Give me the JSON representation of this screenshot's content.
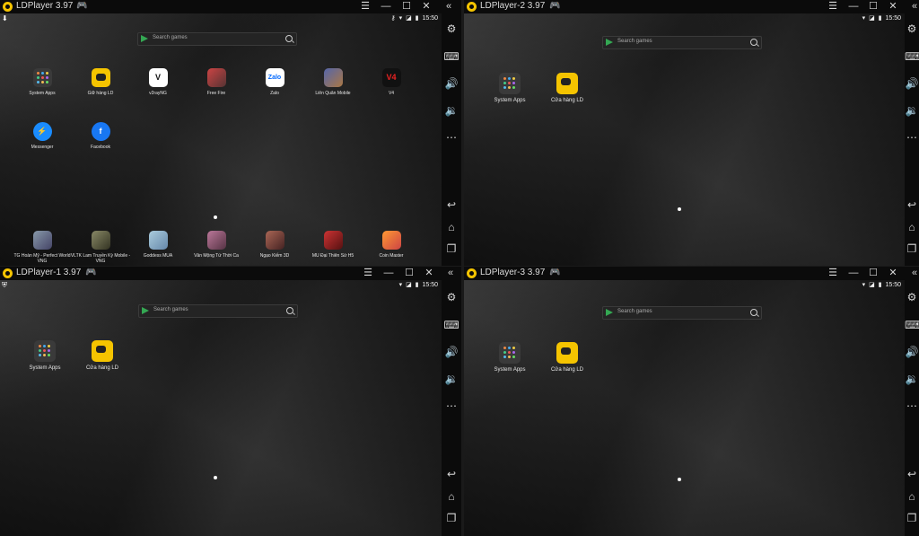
{
  "windows": {
    "w0": {
      "title": "LDPlayer 3.97",
      "time": "15:50",
      "search_placeholder": "Search games",
      "apps_top": [
        "System Apps",
        "Giữ hàng LD",
        "v2rayNG",
        "Free Fire",
        "Zalo",
        "Liên Quân Mobile",
        "V4"
      ],
      "apps_row2": [
        "Messenger",
        "Facebook"
      ],
      "apps_bottom": [
        "TG Hoàn Mỹ - Perfect World VNG",
        "VLTK Lam Truyền Kỳ Mobile - VNG",
        "Goddess MUA",
        "Vân Mộng Tứ Thời Ca",
        "Ngạo Kiếm 3D",
        "MU Đại Thiên Sứ H5",
        "Coin Master"
      ]
    },
    "w1": {
      "title": "LDPlayer-1 3.97",
      "time": "15:50",
      "search_placeholder": "Search games",
      "apps": [
        "System Apps",
        "Cửa hàng LD"
      ]
    },
    "w2": {
      "title": "LDPlayer-2 3.97",
      "time": "15:50",
      "search_placeholder": "Search games",
      "apps": [
        "System Apps",
        "Cửa hàng LD"
      ]
    },
    "w3": {
      "title": "LDPlayer-3 3.97",
      "time": "15:50",
      "search_placeholder": "Search games",
      "apps": [
        "System Apps",
        "Cửa hàng LD"
      ]
    }
  },
  "titlebar_buttons": {
    "menu": "☰",
    "minimize": "—",
    "maximize": "☐",
    "close": "✕",
    "collapse": "«"
  },
  "icons": {
    "sidebar": [
      "gear-icon",
      "keyboard-icon",
      "volume-up-icon",
      "volume-down-icon",
      "more-icon",
      "back-icon",
      "home-icon",
      "recents-icon"
    ]
  },
  "colors": {
    "brand": "#f5c400",
    "titlebar": "#0b0b0b",
    "play_green": "#34a853"
  }
}
